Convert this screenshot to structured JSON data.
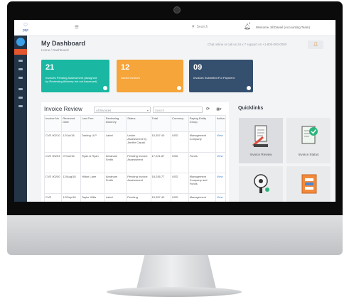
{
  "app": {
    "logo_text": "pqc",
    "search_placeholder": "Search",
    "notification_count": "0",
    "welcome_text": "Welcome Jill Daniel (Accounting Team)"
  },
  "header": {
    "title": "My Dashboard",
    "breadcrumb": "Home / Dashboard",
    "chat_text": "Chat online or call us 24 x 7 support on +1-800-000-0000"
  },
  "tiles": [
    {
      "number": "21",
      "label": "Invoices Pending Assessment (Assigned by Reviewing Attorney but not Assessed)",
      "color": "#1ab8a3"
    },
    {
      "number": "12",
      "label": "Saved Invoices",
      "color": "#f5a539"
    },
    {
      "number": "09",
      "label": "Invoices Submitted For Payment",
      "color": "#354f6e"
    }
  ],
  "invoice_review": {
    "title": "Invoice Review",
    "filter_value": "All Invoices",
    "search_placeholder": "Search",
    "columns": [
      "Invoice No",
      "Received Date",
      "Law Firm",
      "Reviewing Attorney",
      "Status",
      "Total",
      "Currency",
      "Paying Entity Group",
      "Action"
    ],
    "rows": [
      [
        "CVE 00210",
        "12/Jul/18",
        "Darling LLP",
        "Label",
        "Under Assessment by Jenifer Canati",
        "15,357.40",
        "USD",
        "Management Company",
        "View"
      ],
      [
        "CVE 00233",
        "07/Jul/18",
        "Ryan & Ryan",
        "Abraham Smith",
        "Pending Invoice Assessment",
        "17,221.87",
        "USD",
        "Funds",
        "View"
      ],
      [
        "CVE 00200",
        "12/Aug/18",
        "Hilton Lane",
        "Abraham Smith",
        "Pending Invoice Assessment",
        "18,036.77",
        "USD",
        "Management Company and Funds",
        "View"
      ],
      [
        "CVE",
        "12/Sep/18",
        "Taylor Wills",
        "Label",
        "Pending",
        "15,357.40",
        "USD",
        "Management",
        "View"
      ]
    ]
  },
  "quicklinks": {
    "title": "Quicklinks",
    "items": [
      {
        "label": "Invoice Review",
        "icon": "invoice-review-icon"
      },
      {
        "label": "Invoice Status",
        "icon": "invoice-status-icon"
      },
      {
        "label": "",
        "icon": "approval-icon"
      },
      {
        "label": "",
        "icon": "reports-icon"
      }
    ]
  }
}
